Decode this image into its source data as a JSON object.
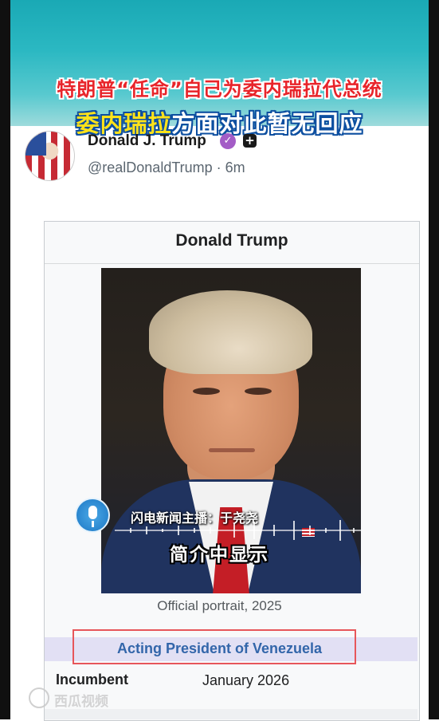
{
  "banner": {
    "headline_line1": "特朗普“任命”自己为委内瑞拉代总统",
    "headline_line2_part1": "委内瑞拉",
    "headline_line2_part2": "方面对此暂无回应"
  },
  "post": {
    "display_name": "Donald J. Trump",
    "handle_time": "@realDonaldTrump · 6m",
    "verified_badge": "✓",
    "plus_badge": "+"
  },
  "infobox": {
    "title": "Donald Trump",
    "portrait_caption": "Official portrait, 2025",
    "role": "Acting President of Venezuela",
    "incumbent_label": "Incumbent",
    "incumbent_date": "January 2026"
  },
  "overlay": {
    "anchor_label": "闪电新闻主播：于尧尧",
    "subtitle": "简介中显示"
  },
  "watermark": {
    "text": "西瓜视频"
  },
  "colors": {
    "banner_red": "#e8242a",
    "banner_yellow": "#ffe21a",
    "verified_purple": "#a35cc6",
    "role_blue": "#3366aa",
    "highlight_box": "#e7565a"
  }
}
